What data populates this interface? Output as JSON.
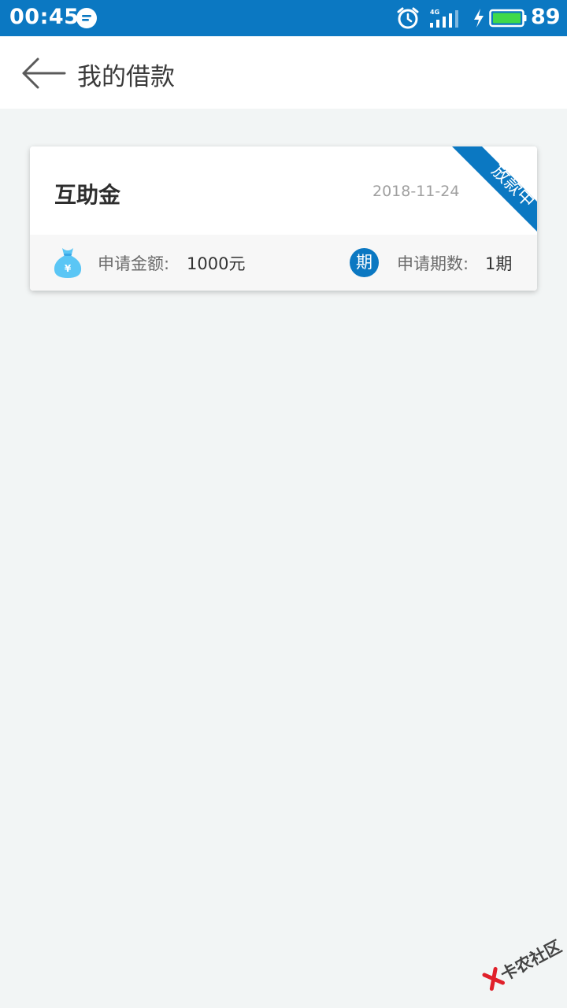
{
  "status_bar": {
    "time": "00:45",
    "network": "4G",
    "battery": "89"
  },
  "header": {
    "title": "我的借款"
  },
  "loan": {
    "name": "互助金",
    "date": "2018-11-24",
    "status": "放款中",
    "amount_label": "申请金额:",
    "amount_value": "1000元",
    "period_badge": "期",
    "period_label": "申请期数:",
    "period_value": "1期"
  },
  "watermark": {
    "text": "卡农社区"
  },
  "colors": {
    "brand": "#0b78c2",
    "background": "#f2f5f5",
    "battery": "#3fd94a",
    "watermark_red": "#e0202a"
  },
  "icons": {
    "back": "arrow-left-icon",
    "message": "message-bubble-icon",
    "alarm": "alarm-clock-icon",
    "signal": "signal-4g-icon",
    "charging": "lightning-bolt-icon",
    "battery": "battery-icon",
    "money": "money-bag-icon"
  }
}
